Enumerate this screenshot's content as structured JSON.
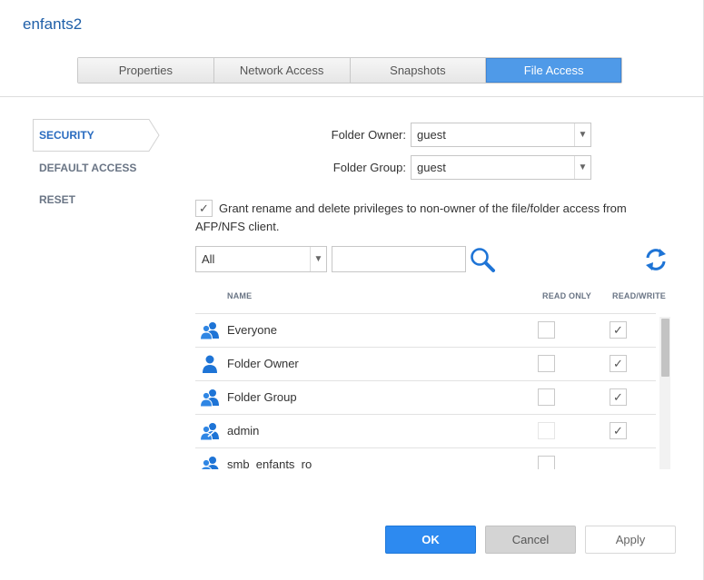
{
  "window": {
    "title": "enfants2"
  },
  "tabs": [
    {
      "label": "Properties",
      "active": false
    },
    {
      "label": "Network Access",
      "active": false
    },
    {
      "label": "Snapshots",
      "active": false
    },
    {
      "label": "File Access",
      "active": true
    }
  ],
  "sidebar": {
    "items": [
      {
        "label": "SECURITY",
        "active": true
      },
      {
        "label": "DEFAULT ACCESS",
        "active": false
      },
      {
        "label": "RESET",
        "active": false
      }
    ]
  },
  "form": {
    "owner_label": "Folder Owner:",
    "owner_value": "guest",
    "group_label": "Folder Group:",
    "group_value": "guest",
    "grant_checked": true,
    "grant_text": "Grant rename and delete privileges to non-owner of the file/folder access from AFP/NFS client."
  },
  "filter": {
    "type_value": "All",
    "search_value": "",
    "search_icon": "search-icon",
    "refresh_icon": "refresh-icon"
  },
  "table": {
    "headers": {
      "name": "NAME",
      "read_only": "READ ONLY",
      "read_write": "READ/WRITE"
    },
    "rows": [
      {
        "name": "Everyone",
        "icon": "group-icon",
        "read_only": false,
        "read_write": true
      },
      {
        "name": "Folder Owner",
        "icon": "user-icon",
        "read_only": false,
        "read_write": true
      },
      {
        "name": "Folder Group",
        "icon": "group-icon",
        "read_only": false,
        "read_write": true
      },
      {
        "name": "admin",
        "icon": "admin-group-icon",
        "read_only": false,
        "read_write": true
      },
      {
        "name": "smb_enfants_ro",
        "icon": "group-icon",
        "read_only": false,
        "read_write": false
      }
    ]
  },
  "footer": {
    "ok_label": "OK",
    "cancel_label": "Cancel",
    "apply_label": "Apply"
  },
  "colors": {
    "accent": "#2d8af0",
    "title": "#1f5fa8",
    "tab_active": "#4f9ae8",
    "sidebar_active": "#2a6cc0"
  }
}
